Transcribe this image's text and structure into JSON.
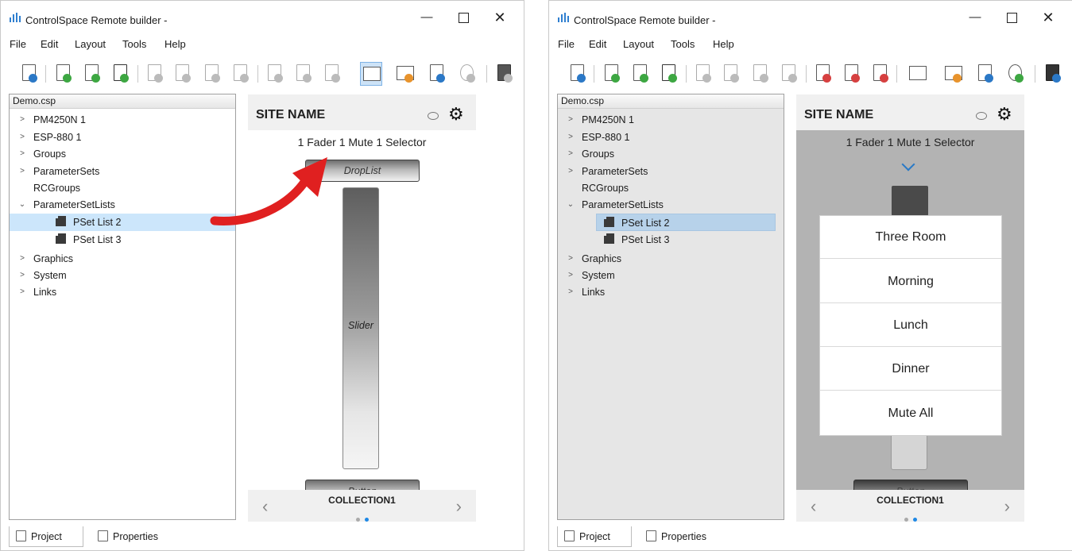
{
  "window_title": "ControlSpace Remote builder -",
  "window_controls": {
    "minimize": "—",
    "maximize": "",
    "close": "✕"
  },
  "menu": [
    "File",
    "Edit",
    "Layout",
    "Tools",
    "Help"
  ],
  "toolbar_icons": [
    "open-project-icon",
    "new-page-icon",
    "refresh-page-icon",
    "save-page-icon",
    "cut-icon",
    "copy-icon",
    "paste-icon",
    "delete-icon",
    "page-icon",
    "page-icon",
    "page-list-icon",
    "layout-mode-icon",
    "grid-icon",
    "page-settings-icon",
    "web-icon",
    "device-icon"
  ],
  "accent_colors": {
    "green": "#3da742",
    "blue": "#2b78c6",
    "orange": "#e8932c",
    "red": "#d64040",
    "selection": "#cce6fb"
  },
  "tree": {
    "root": "Demo.csp",
    "items": [
      {
        "label": "PM4250N 1",
        "expandable": true
      },
      {
        "label": "ESP-880 1",
        "expandable": true
      },
      {
        "label": "Groups",
        "expandable": true
      },
      {
        "label": "ParameterSets",
        "expandable": true
      },
      {
        "label": "RCGroups",
        "expandable": false
      },
      {
        "label": "ParameterSetLists",
        "expanded": true
      },
      {
        "label": "PSet List 2",
        "child": true,
        "selected": true
      },
      {
        "label": "PSet List 3",
        "child": true
      },
      {
        "label": "Graphics",
        "expandable": true
      },
      {
        "label": "System",
        "expandable": true
      },
      {
        "label": "Links",
        "expandable": true
      }
    ]
  },
  "bottom_tabs": {
    "project": "Project",
    "properties": "Properties"
  },
  "preview": {
    "site_name": "SITE NAME",
    "page_title": "1 Fader 1 Mute 1 Selector",
    "droplist_label": "DropList",
    "slider_label": "Slider",
    "button_label": "Button",
    "collection": "COLLECTION1",
    "prev": "‹",
    "next": "›",
    "gear": "⚙"
  },
  "dropdown_options": [
    "Three Room",
    "Morning",
    "Lunch",
    "Dinner",
    "Mute All"
  ]
}
